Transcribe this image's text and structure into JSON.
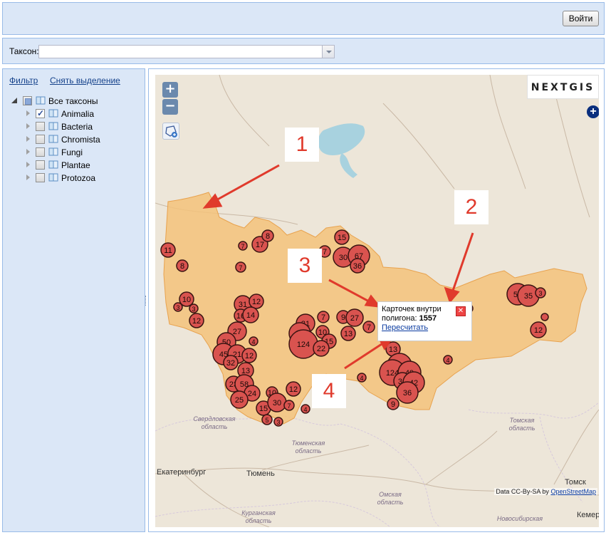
{
  "header": {
    "login_label": "Войти"
  },
  "taxon_filter": {
    "label": "Таксон:",
    "value": ""
  },
  "sidebar": {
    "filter_link": "Фильтр",
    "clear_link": "Снять выделение",
    "tree": [
      {
        "label": "Все таксоны",
        "level": 0,
        "state": "partial",
        "expanded": true
      },
      {
        "label": "Animalia",
        "level": 1,
        "state": "checked",
        "expanded": false
      },
      {
        "label": "Bacteria",
        "level": 1,
        "state": "unchecked",
        "expanded": false
      },
      {
        "label": "Chromista",
        "level": 1,
        "state": "unchecked",
        "expanded": false
      },
      {
        "label": "Fungi",
        "level": 1,
        "state": "unchecked",
        "expanded": false
      },
      {
        "label": "Plantae",
        "level": 1,
        "state": "unchecked",
        "expanded": false
      },
      {
        "label": "Protozoa",
        "level": 1,
        "state": "unchecked",
        "expanded": false
      }
    ]
  },
  "map": {
    "zoom_in": "+",
    "zoom_out": "−",
    "logo": "NEXTGIS",
    "popup": {
      "line1": "Карточек внутри",
      "line2_label": "полигона:",
      "count": "1557",
      "recalc_link": "Пересчитать"
    },
    "attribution_prefix": "Data CC-By-SA by",
    "attribution_link": "OpenStreetMap",
    "cities": [
      "Екатеринбург",
      "Тюмень",
      "Томск",
      "Кемер"
    ],
    "regions": [
      "Свердловская область",
      "Тюменская область",
      "Омская область",
      "Курганская область",
      "Томская область",
      "Новосибирская"
    ],
    "callouts": [
      "1",
      "2",
      "3",
      "4"
    ],
    "clusters": [
      {
        "n": "11"
      },
      {
        "n": "8"
      },
      {
        "n": "17"
      },
      {
        "n": "8"
      },
      {
        "n": "7"
      },
      {
        "n": "7"
      },
      {
        "n": "15"
      },
      {
        "n": "7"
      },
      {
        "n": "30"
      },
      {
        "n": "67"
      },
      {
        "n": "36"
      },
      {
        "n": "10"
      },
      {
        "n": "3"
      },
      {
        "n": "3"
      },
      {
        "n": "12"
      },
      {
        "n": "31"
      },
      {
        "n": "12"
      },
      {
        "n": "16"
      },
      {
        "n": "14"
      },
      {
        "n": "27"
      },
      {
        "n": "50"
      },
      {
        "n": "45"
      },
      {
        "n": "21"
      },
      {
        "n": "12"
      },
      {
        "n": "4"
      },
      {
        "n": "32"
      },
      {
        "n": "13"
      },
      {
        "n": "23"
      },
      {
        "n": "58"
      },
      {
        "n": "24"
      },
      {
        "n": "25"
      },
      {
        "n": "10"
      },
      {
        "n": "15"
      },
      {
        "n": "30"
      },
      {
        "n": "7"
      },
      {
        "n": "5"
      },
      {
        "n": "3"
      },
      {
        "n": "4"
      },
      {
        "n": "12"
      },
      {
        "n": "31"
      },
      {
        "n": "7"
      },
      {
        "n": "34"
      },
      {
        "n": "10"
      },
      {
        "n": "124"
      },
      {
        "n": "15"
      },
      {
        "n": "22"
      },
      {
        "n": "9"
      },
      {
        "n": "27"
      },
      {
        "n": "13"
      },
      {
        "n": "7"
      },
      {
        "n": "13"
      },
      {
        "n": "54"
      },
      {
        "n": "124"
      },
      {
        "n": "49"
      },
      {
        "n": "34"
      },
      {
        "n": "42"
      },
      {
        "n": "36"
      },
      {
        "n": "9"
      },
      {
        "n": "4"
      },
      {
        "n": "4"
      },
      {
        "n": "50"
      },
      {
        "n": "35"
      },
      {
        "n": "3"
      },
      {
        "n": "2"
      },
      {
        "n": "12"
      },
      {
        "n": "4"
      }
    ]
  },
  "colors": {
    "panel_bg": "#dbe7f7",
    "panel_border": "#99bbe8",
    "polygon": "#f3c27a",
    "cluster": "#d9534f",
    "callout_text": "#e03a2c"
  }
}
